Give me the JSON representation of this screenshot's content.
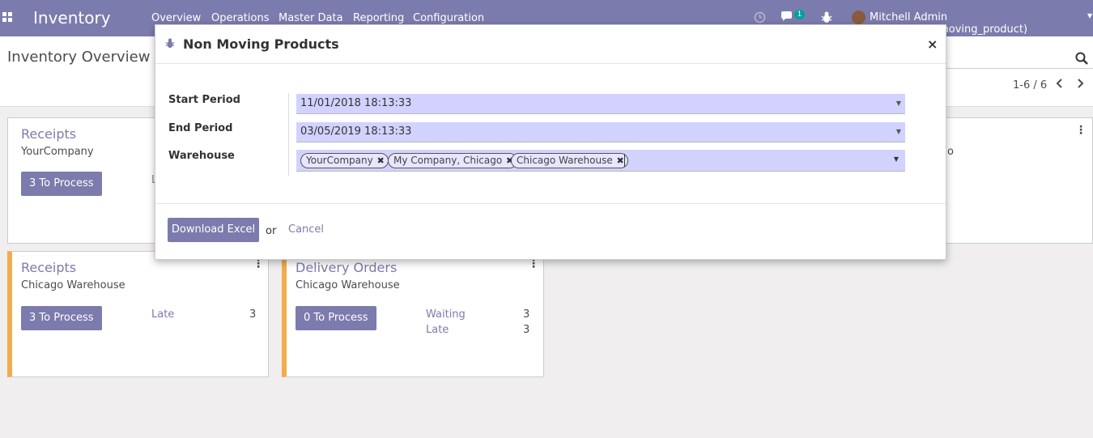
{
  "navbar": {
    "app_title": "Inventory",
    "menu": [
      "Overview",
      "Operations",
      "Master Data",
      "Reporting",
      "Configuration"
    ],
    "chat_count": "1",
    "user": "Mitchell Admin (v12_bi_non_moving_product)",
    "icons": [
      "apps-grid-icon",
      "clock-icon",
      "chat-icon",
      "bug-icon",
      "avatar",
      "caret-down-icon"
    ]
  },
  "control_panel": {
    "title": "Inventory Overview",
    "pager": "1-6 / 6"
  },
  "cards": [
    {
      "title": "Receipts",
      "subtitle": "YourCompany",
      "button": "3 To Process",
      "stat_label": "L",
      "stat_value": ""
    },
    {
      "title": "Receipts",
      "subtitle": "Chicago Warehouse",
      "button": "3 To Process",
      "stat_label": "Late",
      "stat_value": "3"
    },
    {
      "title": "Delivery Orders",
      "subtitle": "Chicago Warehouse",
      "button": "0 To Process",
      "stats": [
        {
          "label": "Waiting",
          "value": "3"
        },
        {
          "label": "Late",
          "value": "3"
        }
      ]
    },
    {
      "partial_text": "o"
    }
  ],
  "modal": {
    "title": "Non Moving Products",
    "fields": {
      "start_period": {
        "label": "Start Period",
        "value": "11/01/2018 18:13:33"
      },
      "end_period": {
        "label": "End Period",
        "value": "03/05/2019 18:13:33"
      },
      "warehouse": {
        "label": "Warehouse",
        "tags": [
          "YourCompany",
          "My Company, Chicago",
          "Chicago Warehouse"
        ]
      }
    },
    "footer": {
      "download_label": "Download Excel",
      "or_text": "or",
      "cancel_label": "Cancel"
    }
  }
}
